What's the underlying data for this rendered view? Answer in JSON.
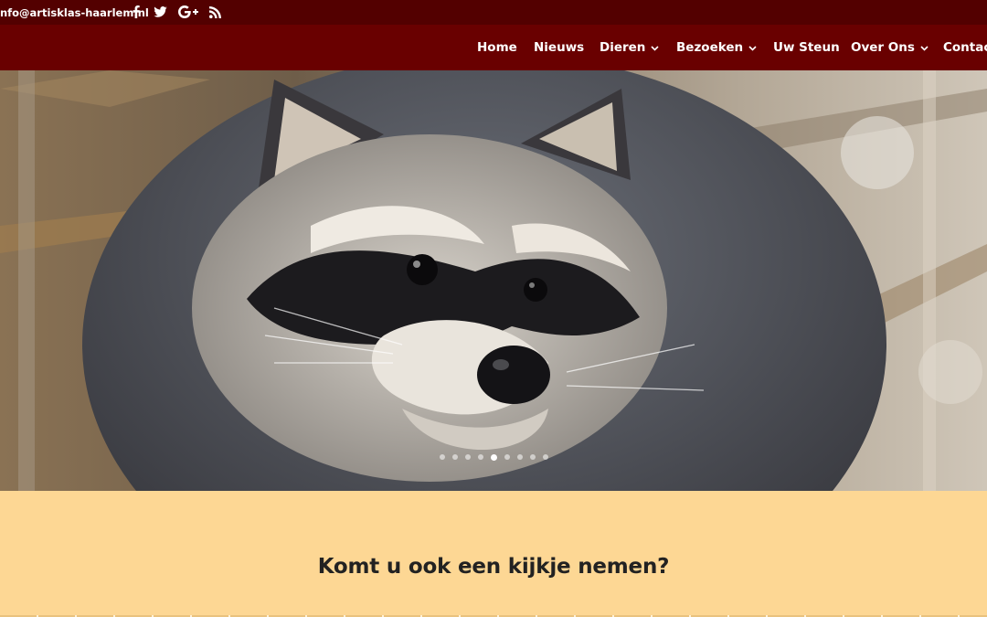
{
  "topbar": {
    "email": "info@artisklas-haarlem.nl",
    "social": [
      "facebook-icon",
      "twitter-icon",
      "google-plus-icon",
      "rss-icon"
    ],
    "background": "#530000"
  },
  "nav": {
    "background": "#690000",
    "items": [
      {
        "label": "Home",
        "dropdown": false
      },
      {
        "label": "Nieuws",
        "dropdown": false
      },
      {
        "label": "Dieren",
        "dropdown": true
      },
      {
        "label": "Bezoeken",
        "dropdown": true
      },
      {
        "label": "Uw Steun",
        "dropdown": false
      },
      {
        "label": "Over Ons",
        "dropdown": true
      },
      {
        "label": "Contact",
        "dropdown": false
      }
    ]
  },
  "hero": {
    "image": "raccoon-photo",
    "slides_count": 9,
    "active_slide": 5
  },
  "cta": {
    "title": "Komt u ook een kijkje nemen?",
    "background": "#fdd794"
  }
}
